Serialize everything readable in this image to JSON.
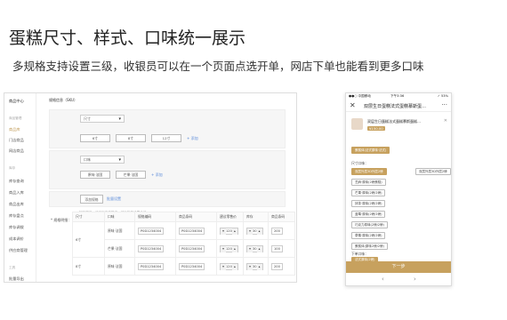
{
  "page": {
    "title": "蛋糕尺寸、样式、口味统一展示",
    "subtitle": "多规格支持设置三级，收银员可以在一个页面点选开单，网店下单也能看到更多口味"
  },
  "admin": {
    "sidebar": {
      "header": "商品中心",
      "items": [
        {
          "label": "商品管理",
          "kind": "group"
        },
        {
          "label": "商品库",
          "kind": "active"
        },
        {
          "label": "门店商品",
          "kind": "item"
        },
        {
          "label": "网店商品",
          "kind": "item"
        },
        {
          "label": "库存",
          "kind": "group"
        },
        {
          "label": "库存查询",
          "kind": "item"
        },
        {
          "label": "商品入库",
          "kind": "item"
        },
        {
          "label": "商品出库",
          "kind": "item"
        },
        {
          "label": "库存盘点",
          "kind": "item"
        },
        {
          "label": "库存调拨",
          "kind": "item"
        },
        {
          "label": "成本调价",
          "kind": "item"
        },
        {
          "label": "供应商管理",
          "kind": "item"
        },
        {
          "label": "工具",
          "kind": "group"
        },
        {
          "label": "批量导出",
          "kind": "item"
        }
      ]
    },
    "section_title": "规格信息（SKU）",
    "spec_label": "规格设置：",
    "spec1": {
      "select": "尺寸",
      "chips": [
        "6寸",
        "8寸",
        "12寸"
      ],
      "add": "+ 添加"
    },
    "spec2": {
      "select": "口味",
      "chips": [
        "原味·法国",
        "芒果·法国"
      ],
      "add": "+ 添加"
    },
    "spec_buttons": {
      "add_spec": "添加规格",
      "batch": "批量设置"
    },
    "note": "如有规格，可添加多种规格，然后批量设置价格。",
    "stock_label": "* 规格明细：",
    "table": {
      "headers": [
        "尺寸",
        "口味",
        "规格编码",
        "商品条码",
        "建议零售价",
        "库存",
        "商品条码"
      ],
      "rows": [
        {
          "size": "6寸",
          "flavor": "原味·法国",
          "code": "P0D1234004",
          "barcode": "P0D1234004",
          "price": "120",
          "stock": "30",
          "extra": "200"
        },
        {
          "size": "",
          "flavor": "芒果·法国",
          "code": "P0D1234004",
          "barcode": "P0D1234004",
          "price": "120",
          "stock": "30",
          "extra": "100"
        },
        {
          "size": "8寸",
          "flavor": "原味·法国",
          "code": "P0D1234004",
          "barcode": "P0D1234004",
          "price": "120",
          "stock": "30",
          "extra": "200"
        }
      ]
    }
  },
  "phone": {
    "status": {
      "carrier": "●●○ 中国移动",
      "time": "下午3:36",
      "battery": "✓ 53%"
    },
    "nav": {
      "close": "✕",
      "title": "双层生日蛋糕法式蛋糕慕斯蛋…",
      "more": "···"
    },
    "product": {
      "name": "双层生日蛋糕法式蛋糕慕斯蛋糕…",
      "price": "¥150.00",
      "close": "✕"
    },
    "selected_chip": "蛋糕体(法式原味·法式)",
    "groups": [
      {
        "label": "尺寸口味：",
        "options": [
          {
            "text": "双层外层3D外层2磅",
            "on": true
          },
          {
            "text": "双层外层3D外层2磅",
            "on": false
          }
        ]
      },
      {
        "label": "",
        "options": [
          {
            "text": "芝麻·原味(2磅蛋糕)",
            "on": false
          }
        ]
      },
      {
        "label": "",
        "options": [
          {
            "text": "芒果·原味(2磅/2磅)",
            "on": false
          }
        ]
      },
      {
        "label": "",
        "options": [
          {
            "text": "抹茶·原味(2磅/2磅)",
            "on": false
          }
        ]
      },
      {
        "label": "",
        "options": [
          {
            "text": "蓝莓·原味(2磅/2磅)",
            "on": false
          }
        ]
      },
      {
        "label": "",
        "options": [
          {
            "text": "巧克力原味(2磅/2磅)",
            "on": false
          }
        ]
      },
      {
        "label": "",
        "options": [
          {
            "text": "草莓·原味(2磅/2磅)",
            "on": false
          }
        ]
      },
      {
        "label": "",
        "options": [
          {
            "text": "蛋糕体(原味2磅/2磅)",
            "on": false
          }
        ]
      },
      {
        "label": "下单口味：",
        "options": [
          {
            "text": "法式原味(2磅)",
            "on": true
          }
        ]
      }
    ],
    "next_button": "下一步",
    "bottom": {
      "back": "‹",
      "forward": "›"
    }
  },
  "colors": {
    "accent": "#c7a15e",
    "link": "#5b8bd9"
  }
}
